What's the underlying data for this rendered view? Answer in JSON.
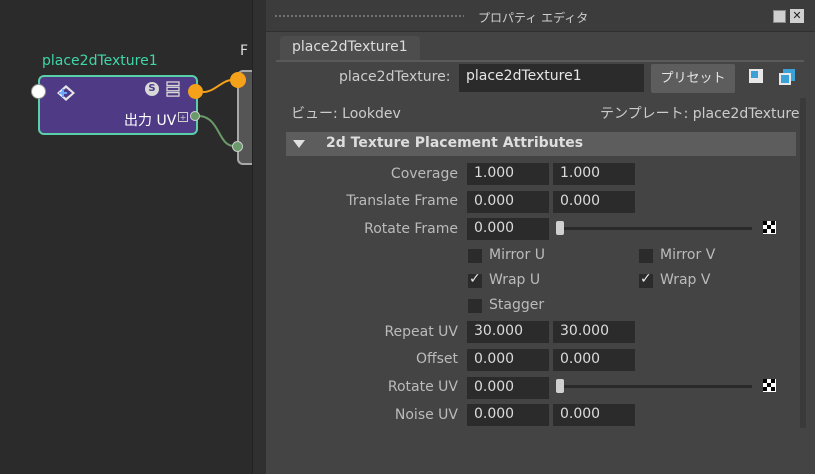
{
  "node_editor": {
    "node_title": "place2dTexture1",
    "output_label": "出力 UV",
    "dest_node_title": "F"
  },
  "attribute_editor": {
    "window_title": "プロパティ エディタ",
    "tab_label": "place2dTexture1",
    "node_type_label": "place2dTexture:",
    "node_name_value": "place2dTexture1",
    "preset_button": "プリセット",
    "view_label": "ビュー: Lookdev",
    "template_label": "テンプレート: place2dTexture",
    "section_title": "2d Texture Placement Attributes",
    "attributes": {
      "coverage": {
        "label": "Coverage",
        "u": "1.000",
        "v": "1.000"
      },
      "translate_frame": {
        "label": "Translate Frame",
        "u": "0.000",
        "v": "0.000"
      },
      "rotate_frame": {
        "label": "Rotate Frame",
        "value": "0.000",
        "slider_fraction": 0.0
      },
      "mirror_u": {
        "label": "Mirror U",
        "checked": false
      },
      "mirror_v": {
        "label": "Mirror V",
        "checked": false
      },
      "wrap_u": {
        "label": "Wrap U",
        "checked": true
      },
      "wrap_v": {
        "label": "Wrap V",
        "checked": true
      },
      "stagger": {
        "label": "Stagger",
        "checked": false
      },
      "repeat_uv": {
        "label": "Repeat UV",
        "u": "30.000",
        "v": "30.000"
      },
      "offset": {
        "label": "Offset",
        "u": "0.000",
        "v": "0.000"
      },
      "rotate_uv": {
        "label": "Rotate UV",
        "value": "0.000",
        "slider_fraction": 0.0
      },
      "noise_uv": {
        "label": "Noise UV",
        "u": "0.000",
        "v": "0.000"
      }
    }
  },
  "colors": {
    "node_fill": "#4f3a86",
    "node_border": "#5ad0a8",
    "node_title": "#3fd7a6",
    "output_port": "#f5a21a"
  }
}
